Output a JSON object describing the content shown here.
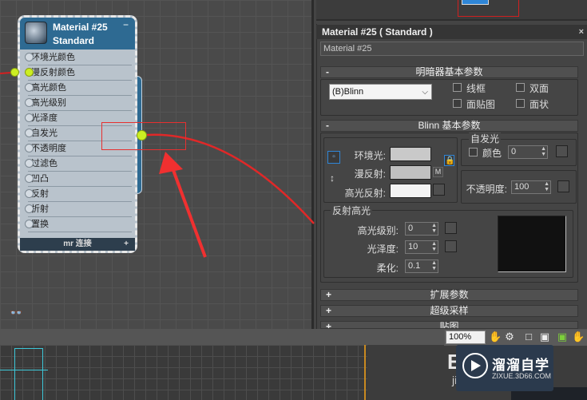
{
  "node": {
    "title": "Material #25",
    "subtitle": "Standard",
    "collapse": "−",
    "slots": [
      "环境光颜色",
      "漫反射颜色",
      "高光颜色",
      "高光级别",
      "光泽度",
      "自发光",
      "不透明度",
      "过滤色",
      "凹凸",
      "反射",
      "折射",
      "置换"
    ],
    "footer": "mr 连接",
    "footer_plus": "+"
  },
  "panel": {
    "title": "Material #25 ( Standard )",
    "close": "×",
    "name_value": "Material #25",
    "rollouts": {
      "shader_basic": "明暗器基本参数",
      "blinn_basic": "Blinn 基本参数",
      "extended": "扩展参数",
      "supersampling": "超级采样",
      "maps": "贴图"
    },
    "rollout_signs": {
      "minus": "-",
      "plus": "+"
    },
    "shader": {
      "selected": "(B)Blinn",
      "options": {
        "wire": "线框",
        "two_sided": "双面",
        "face_map": "面贴图",
        "faceted": "面状"
      }
    },
    "blinn": {
      "ambient_label": "环境光:",
      "diffuse_label": "漫反射:",
      "specular_label": "高光反射:",
      "map_btn": "M",
      "self_illum_legend": "自发光",
      "color_label": "颜色",
      "self_illum_value": "0",
      "opacity_label": "不透明度:",
      "opacity_value": "100"
    },
    "specular_highlights": {
      "legend": "反射高光",
      "level_label": "高光级别:",
      "level_value": "0",
      "gloss_label": "光泽度:",
      "gloss_value": "10",
      "soften_label": "柔化:",
      "soften_value": "0.1"
    }
  },
  "toolbar": {
    "zoom": "100%"
  },
  "watermark": {
    "name": "溜溜自学",
    "url": "ZIXUE.3D66.COM"
  },
  "viewport": {
    "eh_text": "E",
    "ji_text": "ji"
  }
}
